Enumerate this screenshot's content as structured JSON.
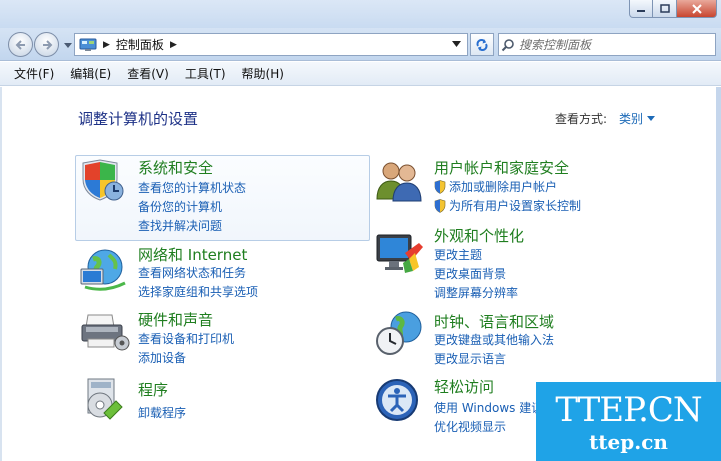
{
  "address": {
    "breadcrumb": [
      "控制面板"
    ],
    "search_placeholder": "搜索控制面板"
  },
  "menu": [
    "文件(F)",
    "编辑(E)",
    "查看(V)",
    "工具(T)",
    "帮助(H)"
  ],
  "main": {
    "title": "调整计算机的设置",
    "view_by_label": "查看方式:",
    "view_by_value": "类别"
  },
  "categories": {
    "system_security": {
      "title": "系统和安全",
      "links": [
        "查看您的计算机状态",
        "备份您的计算机",
        "查找并解决问题"
      ]
    },
    "network": {
      "title": "网络和 Internet",
      "links": [
        "查看网络状态和任务",
        "选择家庭组和共享选项"
      ]
    },
    "hardware": {
      "title": "硬件和声音",
      "links": [
        "查看设备和打印机",
        "添加设备"
      ]
    },
    "programs": {
      "title": "程序",
      "links": [
        "卸载程序"
      ]
    },
    "user_accounts": {
      "title": "用户帐户和家庭安全",
      "links": [
        "添加或删除用户帐户",
        "为所有用户设置家长控制"
      ]
    },
    "appearance": {
      "title": "外观和个性化",
      "links": [
        "更改主题",
        "更改桌面背景",
        "调整屏幕分辨率"
      ]
    },
    "clock": {
      "title": "时钟、语言和区域",
      "links": [
        "更改键盘或其他输入法",
        "更改显示语言"
      ]
    },
    "ease": {
      "title": "轻松访问",
      "links": [
        "使用 Windows 建议",
        "优化视频显示"
      ]
    }
  },
  "watermark": {
    "main": "TTEP.CN",
    "sub": "ttep.cn"
  }
}
